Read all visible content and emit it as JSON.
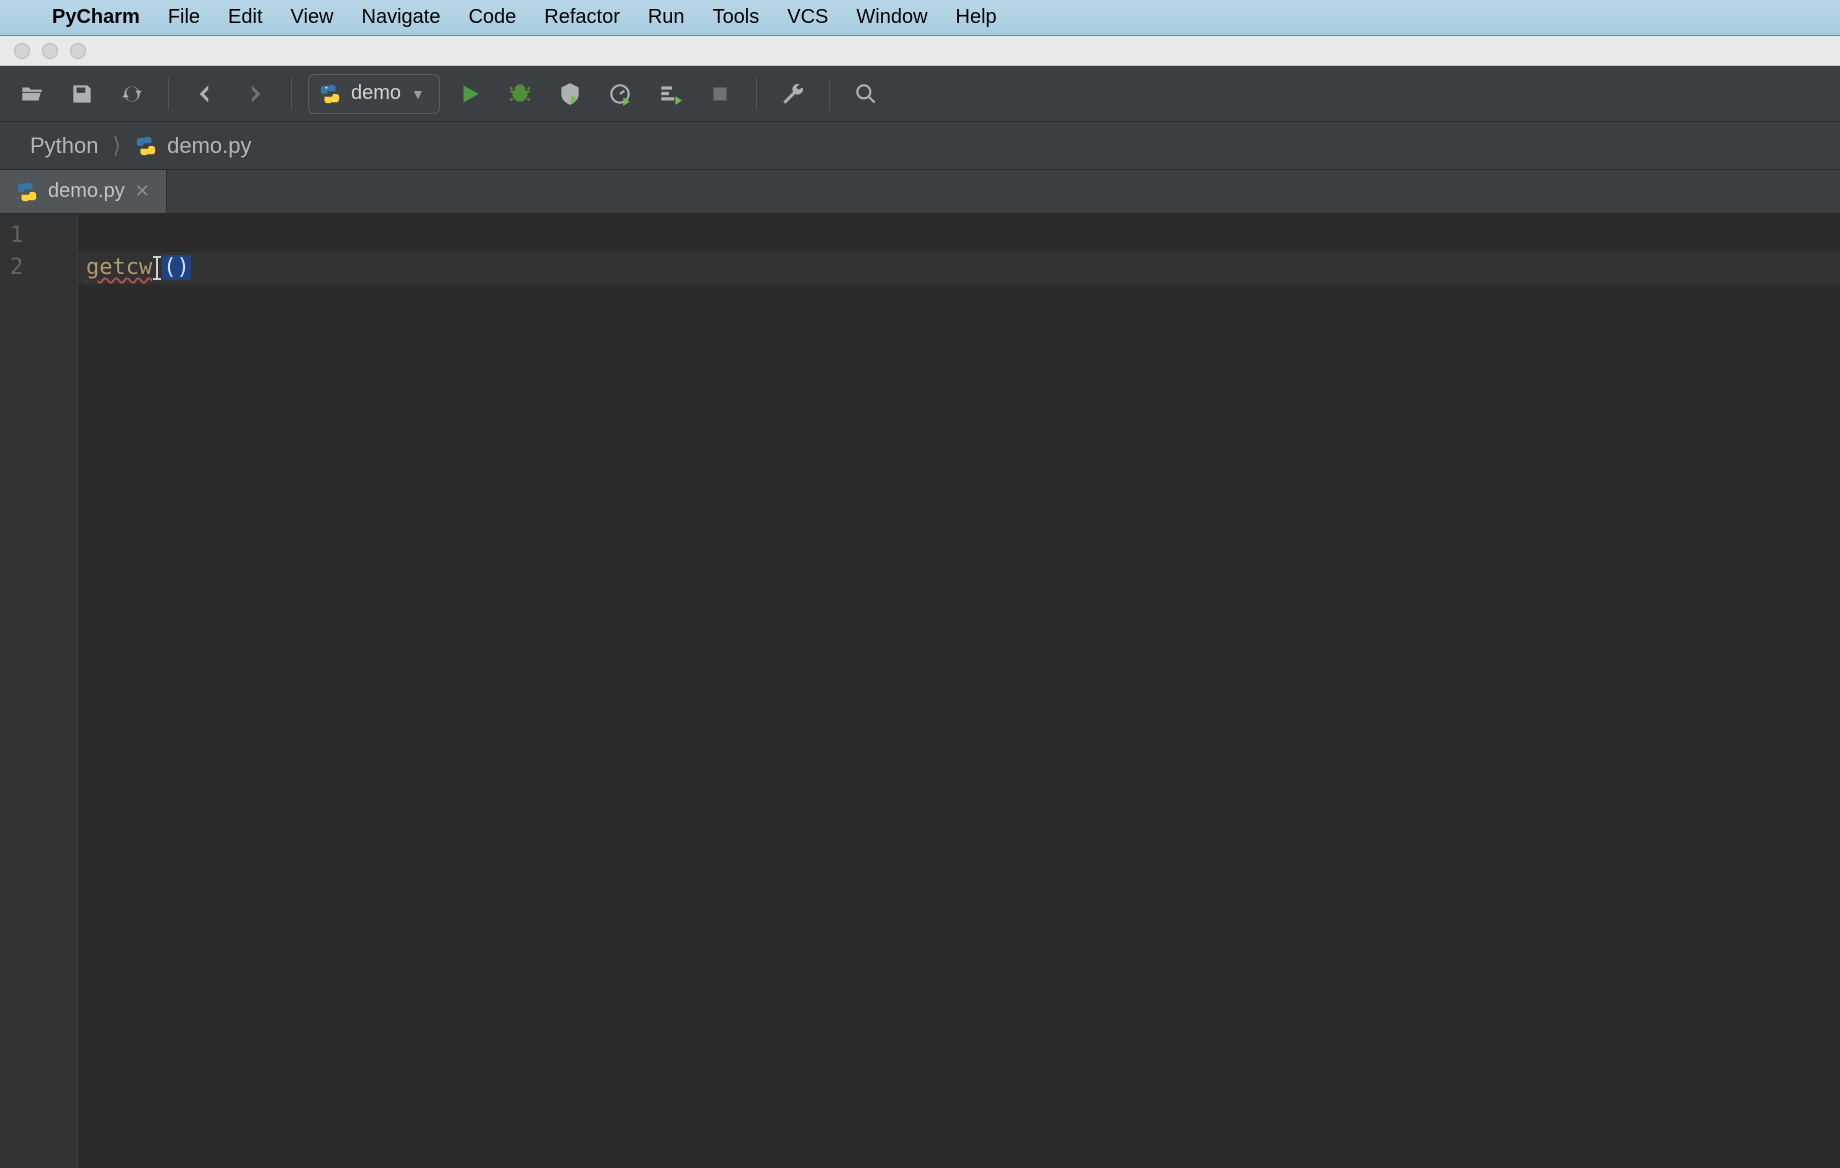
{
  "mac_menubar": {
    "app": "PyCharm",
    "items": [
      "File",
      "Edit",
      "View",
      "Navigate",
      "Code",
      "Refactor",
      "Run",
      "Tools",
      "VCS",
      "Window",
      "Help"
    ]
  },
  "run_config": {
    "label": "demo"
  },
  "breadcrumb": {
    "root": "Python",
    "file": "demo.py"
  },
  "tabs": [
    {
      "label": "demo.py"
    }
  ],
  "editor": {
    "lines": [
      "1",
      "2"
    ],
    "code": {
      "line2_func": "getcw",
      "line2_tail": "()"
    }
  },
  "colors": {
    "run_green": "#4e9a45",
    "editor_bg": "#2b2b2b",
    "chrome_bg": "#3c3f41"
  }
}
